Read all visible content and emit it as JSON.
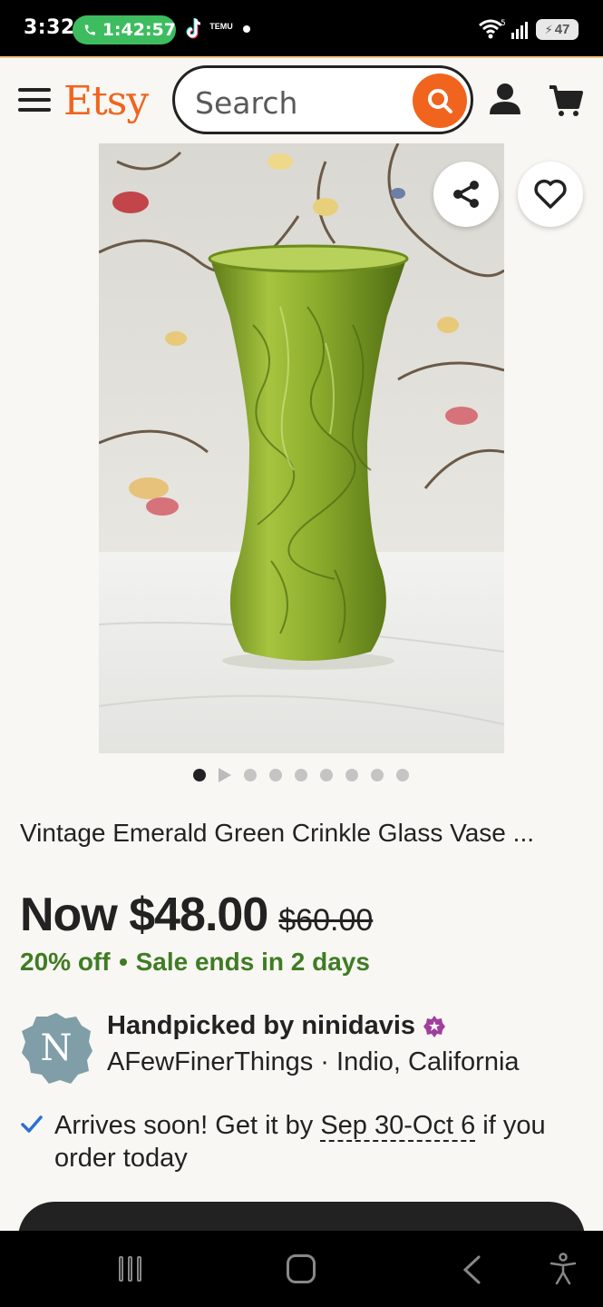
{
  "status_bar": {
    "time": "3:32",
    "call_timer": "1:42:57",
    "temu_label": "TEMU",
    "battery": "47"
  },
  "header": {
    "logo": "Etsy",
    "search_placeholder": "Search"
  },
  "gallery": {
    "image_count": 9,
    "active_index": 0
  },
  "product": {
    "title": "Vintage Emerald Green Crinkle Glass Vase ...",
    "price_now": "Now $48.00",
    "price_old": "$60.00",
    "discount": "20% off",
    "sale_ends": "Sale ends in 2 days"
  },
  "seller": {
    "avatar_letter": "N",
    "handpicked": "Handpicked by ninidavis",
    "shop": "AFewFinerThings · Indio, California"
  },
  "delivery": {
    "prefix": "Arrives soon! Get it by ",
    "date_range": "Sep 30-Oct 6",
    "suffix": " if you order today"
  },
  "colors": {
    "accent": "#f1641e",
    "sale_green": "#3f7c24",
    "check_blue": "#2b6fd6"
  }
}
